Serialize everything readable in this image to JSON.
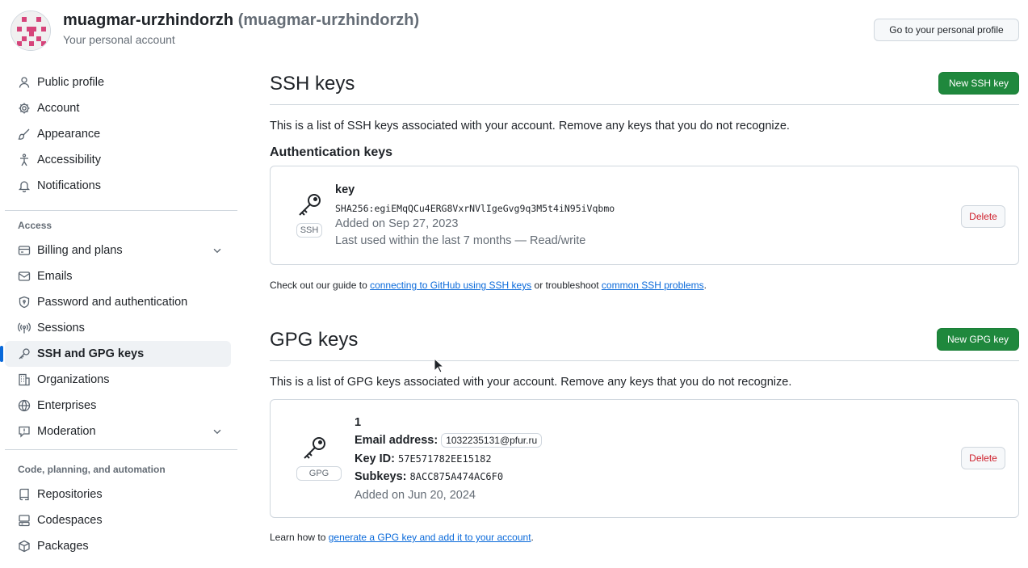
{
  "header": {
    "account_name": "muagmar-urzhindorzh",
    "account_login": "(muagmar-urzhindorzh)",
    "account_subtitle": "Your personal account",
    "profile_button": "Go to your personal profile"
  },
  "sidebar": {
    "items_top": [
      {
        "label": "Public profile",
        "icon": "person-icon"
      },
      {
        "label": "Account",
        "icon": "gear-icon"
      },
      {
        "label": "Appearance",
        "icon": "paintbrush-icon"
      },
      {
        "label": "Accessibility",
        "icon": "accessibility-icon"
      },
      {
        "label": "Notifications",
        "icon": "bell-icon"
      }
    ],
    "group_access": "Access",
    "items_access": [
      {
        "label": "Billing and plans",
        "icon": "credit-card-icon"
      },
      {
        "label": "Emails",
        "icon": "mail-icon"
      },
      {
        "label": "Password and authentication",
        "icon": "shield-icon"
      },
      {
        "label": "Sessions",
        "icon": "broadcast-icon"
      },
      {
        "label": "SSH and GPG keys",
        "icon": "key-icon"
      },
      {
        "label": "Organizations",
        "icon": "organization-icon"
      },
      {
        "label": "Enterprises",
        "icon": "globe-icon"
      },
      {
        "label": "Moderation",
        "icon": "report-icon"
      }
    ],
    "group_code": "Code, planning, and automation",
    "items_code": [
      {
        "label": "Repositories",
        "icon": "repo-icon"
      },
      {
        "label": "Codespaces",
        "icon": "codespaces-icon"
      },
      {
        "label": "Packages",
        "icon": "package-icon"
      }
    ]
  },
  "ssh": {
    "title": "SSH keys",
    "new_button": "New SSH key",
    "description": "This is a list of SSH keys associated with your account. Remove any keys that you do not recognize.",
    "auth_heading": "Authentication keys",
    "key_title": "key",
    "fingerprint": "SHA256:egiEMqQCu4ERG8VxrNVlIgeGvg9q3M5t4iN95iVqbmo",
    "added": "Added on Sep 27, 2023",
    "last_used": "Last used within the last 7 months — Read/write",
    "badge": "SSH",
    "delete_button": "Delete",
    "guide_prefix": "Check out our guide to ",
    "guide_link": "connecting to GitHub using SSH keys",
    "guide_middle": " or troubleshoot ",
    "guide_link2": "common SSH problems",
    "guide_suffix": "."
  },
  "gpg": {
    "title": "GPG keys",
    "new_button": "New GPG key",
    "description": "This is a list of GPG keys associated with your account. Remove any keys that you do not recognize.",
    "key_title": "1",
    "email_label": "Email address:",
    "email": "1032235131@pfur.ru",
    "keyid_label": "Key ID:",
    "keyid": "57E571782EE15182",
    "subkeys_label": "Subkeys:",
    "subkeys": "8ACC875A474AC6F0",
    "added": "Added on Jun 20, 2024",
    "badge": "GPG",
    "delete_button": "Delete",
    "learn_prefix": "Learn how to ",
    "learn_link": "generate a GPG key and add it to your account",
    "learn_suffix": "."
  },
  "colors": {
    "accent": "#0969da",
    "primary_button": "#1f883d",
    "danger": "#cf222e",
    "avatar": "#d6447a"
  }
}
